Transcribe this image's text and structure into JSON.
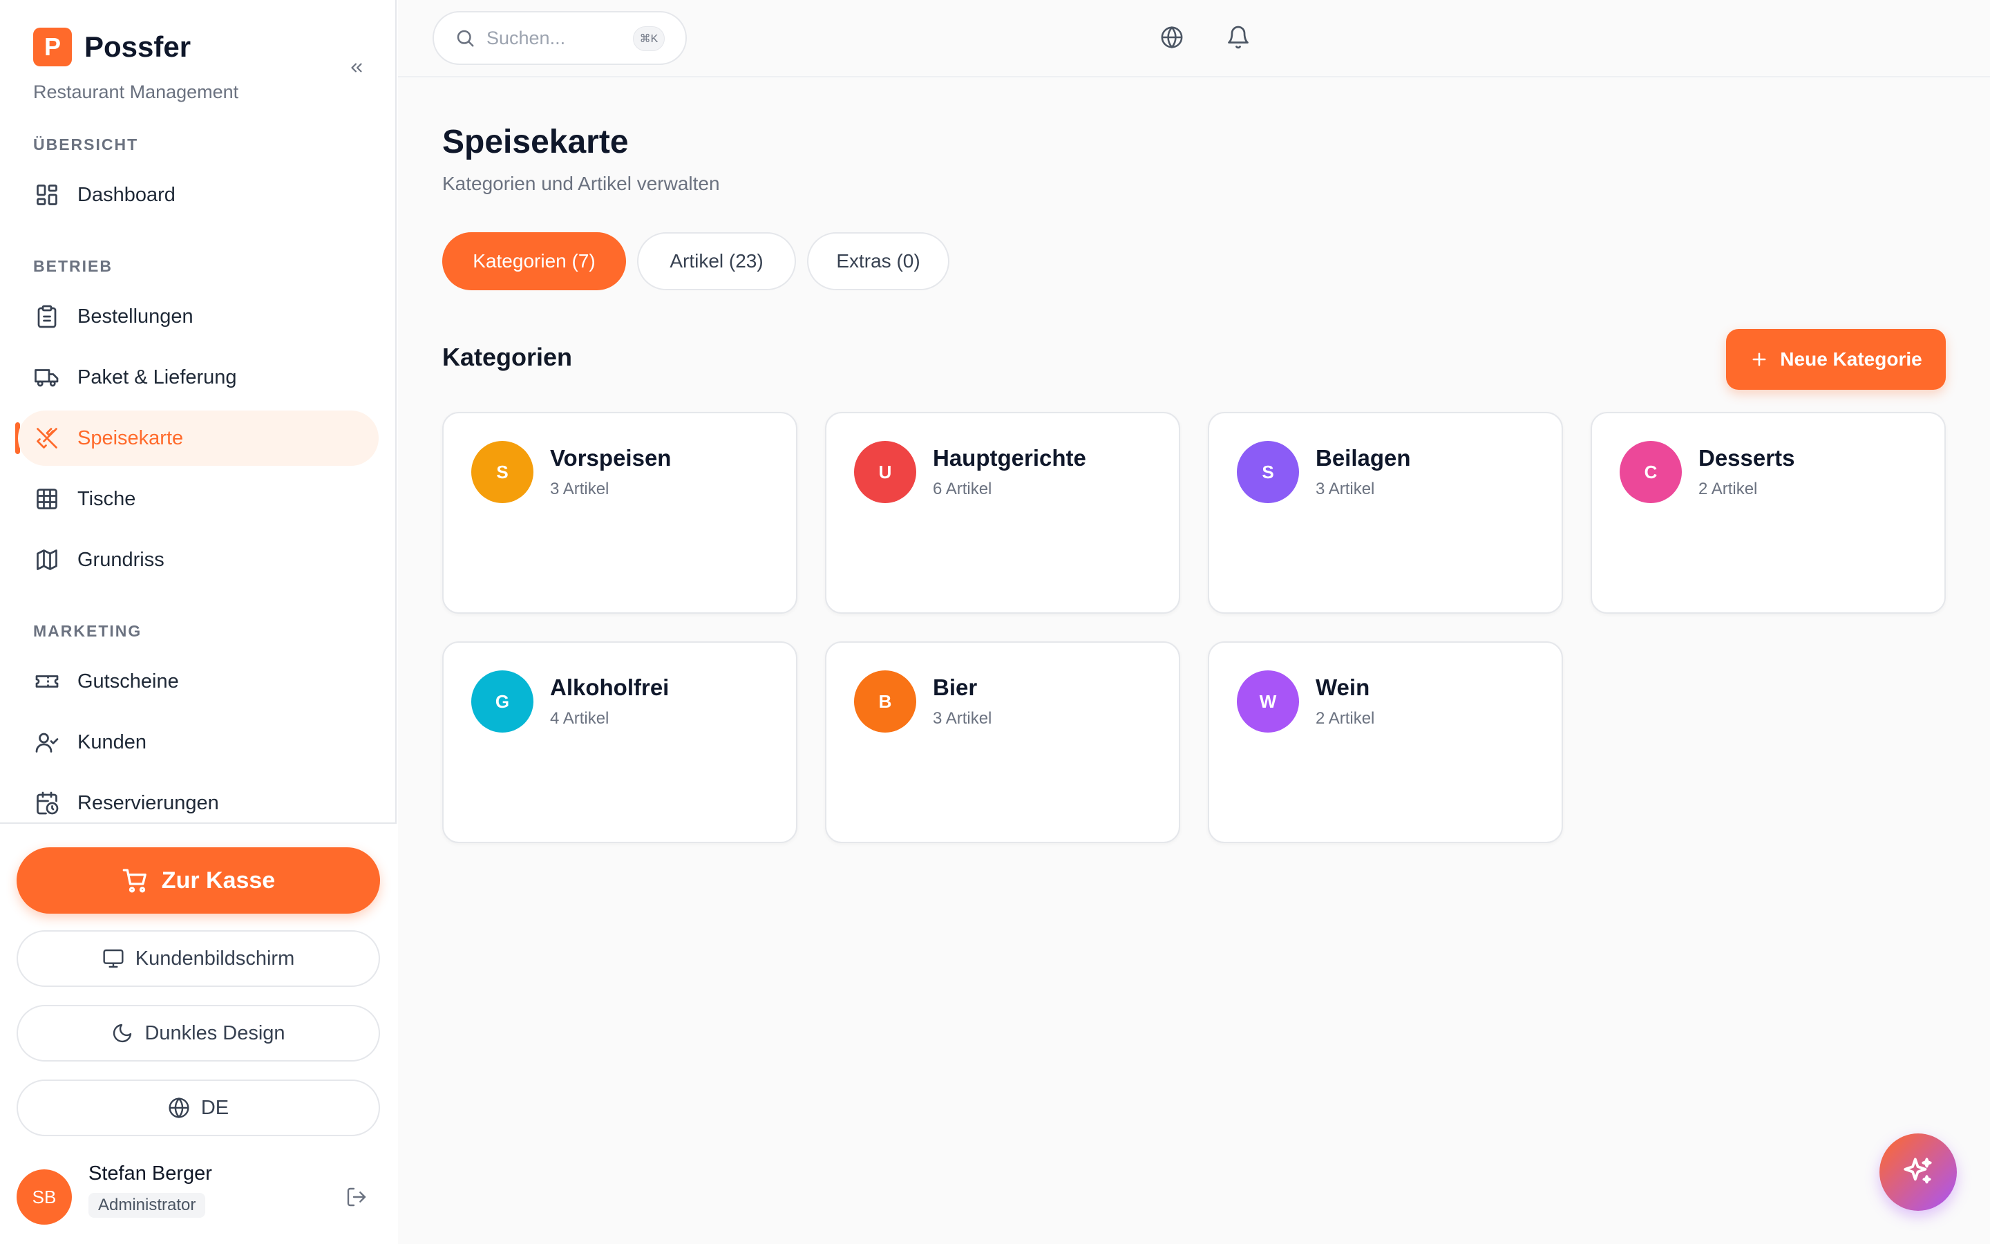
{
  "app": {
    "logo_letter": "P",
    "name": "Possfer",
    "subtitle": "Restaurant Management"
  },
  "sidebar": {
    "sections": [
      {
        "label": "ÜBERSICHT"
      },
      {
        "label": "BETRIEB"
      },
      {
        "label": "MARKETING"
      }
    ],
    "items": [
      {
        "label": "Dashboard",
        "icon": "dashboard-icon"
      },
      {
        "label": "Bestellungen",
        "icon": "clipboard-icon"
      },
      {
        "label": "Paket & Lieferung",
        "icon": "truck-icon"
      },
      {
        "label": "Speisekarte",
        "icon": "utensils-icon",
        "active": true
      },
      {
        "label": "Tische",
        "icon": "grid-icon"
      },
      {
        "label": "Grundriss",
        "icon": "map-icon"
      },
      {
        "label": "Gutscheine",
        "icon": "ticket-icon"
      },
      {
        "label": "Kunden",
        "icon": "user-check-icon"
      },
      {
        "label": "Reservierungen",
        "icon": "calendar-clock-icon"
      }
    ],
    "checkout_label": "Zur Kasse",
    "customer_display_label": "Kundenbildschirm",
    "dark_mode_label": "Dunkles Design",
    "language_label": "DE",
    "user": {
      "initials": "SB",
      "name": "Stefan Berger",
      "role": "Administrator"
    }
  },
  "topbar": {
    "search_placeholder": "Suchen...",
    "shortcut": "⌘K"
  },
  "main": {
    "title": "Speisekarte",
    "subtitle": "Kategorien und Artikel verwalten",
    "tabs": [
      {
        "label": "Kategorien (7)",
        "active": true
      },
      {
        "label": "Artikel (23)"
      },
      {
        "label": "Extras (0)"
      }
    ],
    "section_title": "Kategorien",
    "new_button_label": "Neue Kategorie",
    "categories": [
      {
        "letter": "S",
        "name": "Vorspeisen",
        "count": "3 Artikel",
        "color": "#f59e0b"
      },
      {
        "letter": "U",
        "name": "Hauptgerichte",
        "count": "6 Artikel",
        "color": "#ef4444"
      },
      {
        "letter": "S",
        "name": "Beilagen",
        "count": "3 Artikel",
        "color": "#8b5cf6"
      },
      {
        "letter": "C",
        "name": "Desserts",
        "count": "2 Artikel",
        "color": "#ec4899"
      },
      {
        "letter": "G",
        "name": "Alkoholfrei",
        "count": "4 Artikel",
        "color": "#06b6d4"
      },
      {
        "letter": "B",
        "name": "Bier",
        "count": "3 Artikel",
        "color": "#f97316"
      },
      {
        "letter": "W",
        "name": "Wein",
        "count": "2 Artikel",
        "color": "#a855f7"
      }
    ]
  },
  "colors": {
    "accent": "#ff6a2b",
    "active_bg": "#fff3eb"
  }
}
